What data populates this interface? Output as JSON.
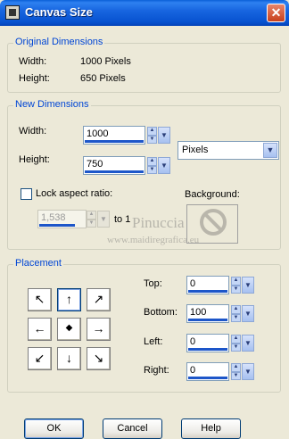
{
  "window": {
    "title": "Canvas Size",
    "close": "✕"
  },
  "original": {
    "title": "Original Dimensions",
    "width_label": "Width:",
    "width_value": "1000 Pixels",
    "height_label": "Height:",
    "height_value": "650 Pixels"
  },
  "new_dims": {
    "title": "New Dimensions",
    "width_label": "Width:",
    "width_value": "1000",
    "height_label": "Height:",
    "height_value": "750",
    "units": "Pixels",
    "lock_label": "Lock aspect ratio:",
    "ratio_value": "1,538",
    "to_label": "to 1",
    "background_label": "Background:"
  },
  "placement": {
    "title": "Placement",
    "top_label": "Top:",
    "top_value": "0",
    "bottom_label": "Bottom:",
    "bottom_value": "100",
    "left_label": "Left:",
    "left_value": "0",
    "right_label": "Right:",
    "right_value": "0",
    "arrows": [
      "↖",
      "↑",
      "↗",
      "←",
      "◆",
      "→",
      "↙",
      "↓",
      "↘"
    ]
  },
  "buttons": {
    "ok": "OK",
    "cancel": "Cancel",
    "help": "Help"
  },
  "watermark": {
    "name": "Pinuccia",
    "site": "www.maidiregrafica.eu"
  }
}
